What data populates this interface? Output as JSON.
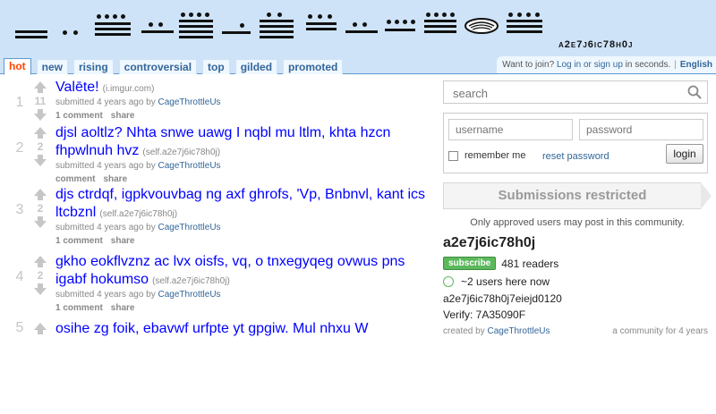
{
  "header": {
    "subreddit_name": "a2e7j6ic78h0j",
    "tabs": [
      {
        "label": "hot",
        "selected": true
      },
      {
        "label": "new",
        "selected": false
      },
      {
        "label": "rising",
        "selected": false
      },
      {
        "label": "controversial",
        "selected": false
      },
      {
        "label": "top",
        "selected": false
      },
      {
        "label": "gilded",
        "selected": false
      },
      {
        "label": "promoted",
        "selected": false
      }
    ],
    "userbar": {
      "prompt": "Want to join?",
      "login_link": "Log in or sign up",
      "suffix": " in seconds.",
      "language": "English"
    }
  },
  "links": [
    {
      "rank": "1",
      "score": "11",
      "title": "Valēte!",
      "domain": "(i.imgur.com)",
      "submitted": "submitted 4 years ago by ",
      "author": "CageThrottleUs",
      "comments": "1 comment",
      "share": "share"
    },
    {
      "rank": "2",
      "score": "2",
      "title": "djsl aoltlz? Nhta snwe uawg I nqbl mu ltlm, khta hzcn fhpwlnuh hvz",
      "domain": "(self.a2e7j6ic78h0j)",
      "submitted": "submitted 4 years ago by ",
      "author": "CageThrottleUs",
      "comments": "comment",
      "share": "share"
    },
    {
      "rank": "3",
      "score": "2",
      "title": "djs ctrdqf, igpkvouvbag ng axf ghrofs, 'Vp, Bnbnvl, kant ics ltcbznl",
      "domain": "(self.a2e7j6ic78h0j)",
      "submitted": "submitted 4 years ago by ",
      "author": "CageThrottleUs",
      "comments": "1 comment",
      "share": "share"
    },
    {
      "rank": "4",
      "score": "2",
      "title": "gkho eokflvznz ac lvx oisfs, vq, o tnxegyqeg ovwus pns igabf hokumso",
      "domain": "(self.a2e7j6ic78h0j)",
      "submitted": "submitted 4 years ago by ",
      "author": "CageThrottleUs",
      "comments": "1 comment",
      "share": "share"
    },
    {
      "rank": "5",
      "score": "",
      "title": "osihe zg foik, ebavwf urfpte yt gpgiw. Mul nhxu W",
      "domain": "",
      "submitted": "",
      "author": "",
      "comments": "",
      "share": ""
    }
  ],
  "sidebar": {
    "search_placeholder": "search",
    "username_placeholder": "username",
    "password_placeholder": "password",
    "remember_label": "remember me",
    "reset_label": "reset password",
    "login_label": "login",
    "restricted_title": "Submissions restricted",
    "restricted_note": "Only approved users may post in this community.",
    "sr_title": "a2e7j6ic78h0j",
    "subscribe_label": "subscribe",
    "readers": "481 readers",
    "online": "~2 users here now",
    "desc_line1": "a2e7j6ic78h0j7eiejd0120",
    "desc_line2": "Verify: 7A35090F",
    "footer_left_prefix": "created by ",
    "footer_left_author": "CageThrottleUs",
    "footer_right": "a community for 4 years"
  }
}
